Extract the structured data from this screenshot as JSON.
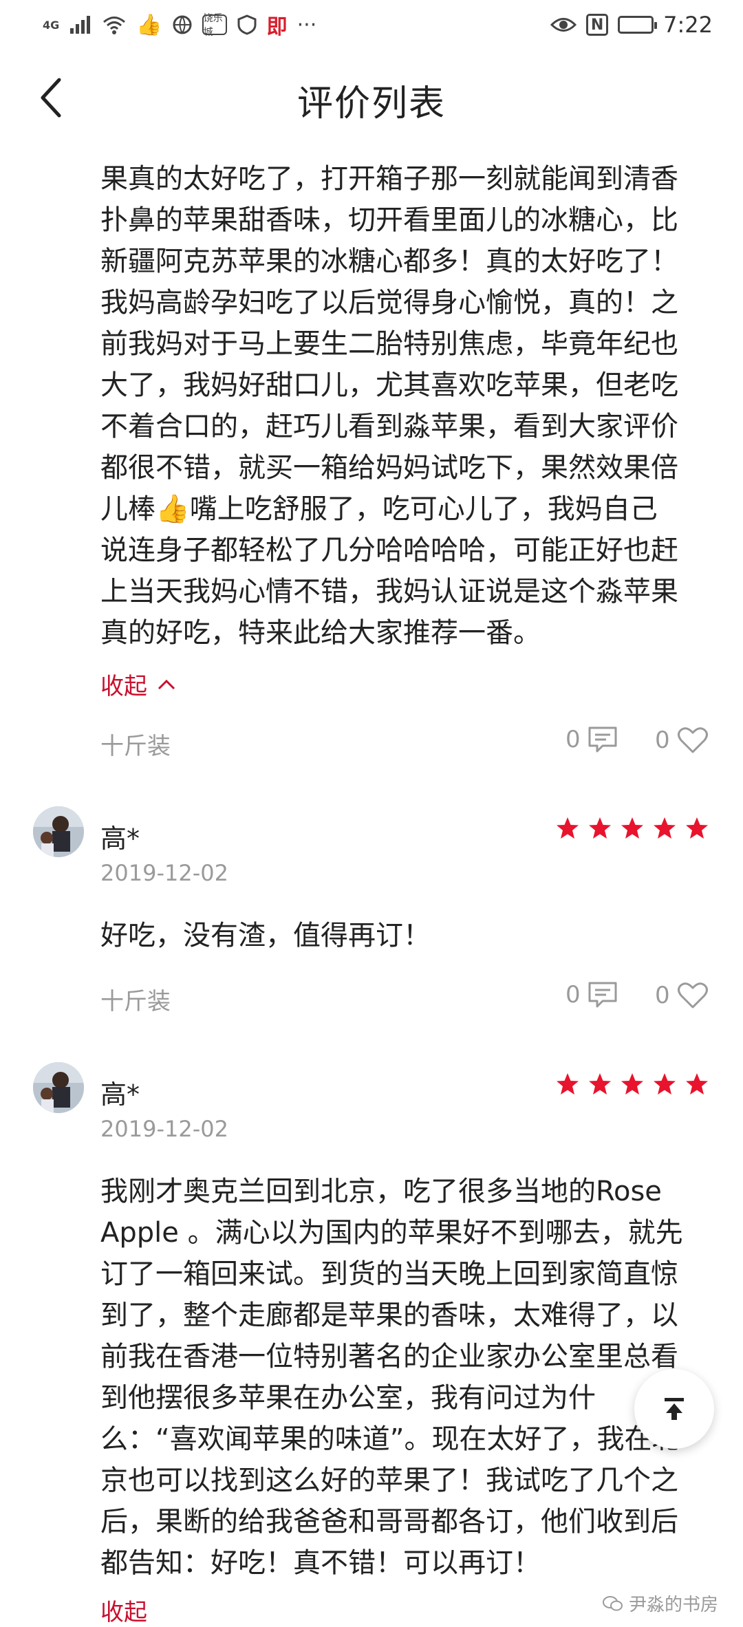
{
  "status_bar": {
    "network": "4G",
    "app_label": "饶乐城",
    "app_red": "即",
    "more": "···",
    "nfc": "N",
    "battery_level": 0.95,
    "time": "7:22"
  },
  "nav": {
    "title": "评价列表"
  },
  "reviews": [
    {
      "lines": [
        "果真的太好吃了，打开箱子那一刻就能闻到清香",
        "扑鼻的苹果甜香味，切开看里面儿的冰糖心，比",
        "新疆阿克苏苹果的冰糖心都多！真的太好吃了！",
        "我妈高龄孕妇吃了以后觉得身心愉悦，真的！之",
        "前我妈对于马上要生二胎特别焦虑，毕竟年纪也",
        "大了，我妈好甜口儿，尤其喜欢吃苹果，但老吃",
        "不着合口的，赶巧儿看到淼苹果，看到大家评价",
        "都很不错，就买一箱给妈妈试吃下，果然效果倍",
        "儿棒👍嘴上吃舒服了，吃可心儿了，我妈自己",
        "说连身子都轻松了几分哈哈哈哈，可能正好也赶",
        "上当天我妈心情不错，我妈认证说是这个淼苹果",
        "真的好吃，特来此给大家推荐一番。"
      ],
      "collapse_label": "收起",
      "spec": "十斤装",
      "comment_count": "0",
      "like_count": "0"
    },
    {
      "user": "高*",
      "date": "2019-12-02",
      "rating": 5,
      "lines": [
        "好吃，没有渣，值得再订！"
      ],
      "spec": "十斤装",
      "comment_count": "0",
      "like_count": "0"
    },
    {
      "user": "高*",
      "date": "2019-12-02",
      "rating": 5,
      "lines": [
        "我刚才奥克兰回到北京，吃了很多当地的Rose",
        "Apple 。满心以为国内的苹果好不到哪去，就先",
        "订了一箱回来试。到货的当天晚上回到家简直惊",
        "到了，整个走廊都是苹果的香味，太难得了，以",
        "前我在香港一位特别著名的企业家办公室里总看",
        "到他摆很多苹果在办公室，我有问过为什",
        "么：“喜欢闻苹果的味道”。现在太好了，我在北",
        "京也可以找到这么好的苹果了！我试吃了几个之",
        "后，果断的给我爸爸和哥哥都各订，他们收到后",
        "都告知：好吃！真不错！可以再订！"
      ],
      "collapse_label": "收起"
    }
  ],
  "watermark": "尹淼的书房",
  "colors": {
    "accent": "#c8102e",
    "muted": "#9a9a9a",
    "star": "#e8132d"
  }
}
